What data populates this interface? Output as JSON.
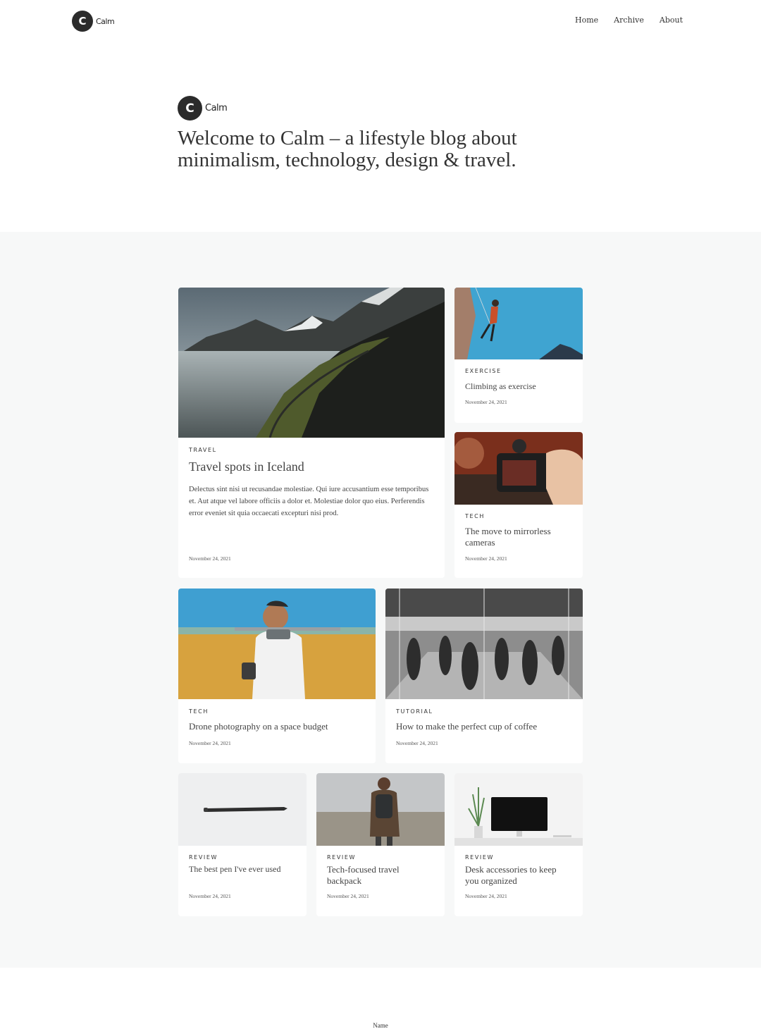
{
  "header": {
    "logo_letter": "C",
    "logo_text": "Calm",
    "nav": [
      "Home",
      "Archive",
      "About"
    ]
  },
  "hero": {
    "logo_letter": "C",
    "logo_text": "Calm",
    "title": "Welcome to Calm – a lifestyle blog about minimalism, technology, design & travel."
  },
  "posts": [
    {
      "category": "TRAVEL",
      "title": "Travel spots in Iceland",
      "excerpt": "Delectus sint nisi ut recusandae molestiae. Qui iure accusantium esse temporibus et. Aut atque vel labore officiis a dolor et. Molestiae dolor quo eius. Perferendis error eveniet sit quia occaecati excepturi nisi prod.",
      "date": "November 24, 2021",
      "image": "iceland-mountain-road"
    },
    {
      "category": "EXERCISE",
      "title": "Climbing as exercise",
      "date": "November 24, 2021",
      "image": "rock-climber"
    },
    {
      "category": "TECH",
      "title": "The move to mirrorless cameras",
      "date": "November 24, 2021",
      "image": "camera-in-hand"
    },
    {
      "category": "TECH",
      "title": "Drone photography on a space budget",
      "date": "November 24, 2021",
      "image": "drone-in-field"
    },
    {
      "category": "TUTORIAL",
      "title": "How to make the perfect cup of coffee",
      "date": "November 24, 2021",
      "image": "busy-station"
    },
    {
      "category": "REVIEW",
      "title": "The best pen I've ever used",
      "date": "November 24, 2021",
      "image": "pen"
    },
    {
      "category": "REVIEW",
      "title": "Tech-focused travel backpack",
      "date": "November 24, 2021",
      "image": "hiker-backpack"
    },
    {
      "category": "REVIEW",
      "title": "Desk accessories to keep you organized",
      "date": "November 24, 2021",
      "image": "desk-monitor"
    }
  ],
  "footer": {
    "name_label": "Name"
  },
  "colors": {
    "page_background": "#ffffff",
    "feed_background": "#f7f8f8",
    "card_background": "#ffffff",
    "logo_mark": "#2b2b2b",
    "text": "#333333"
  }
}
